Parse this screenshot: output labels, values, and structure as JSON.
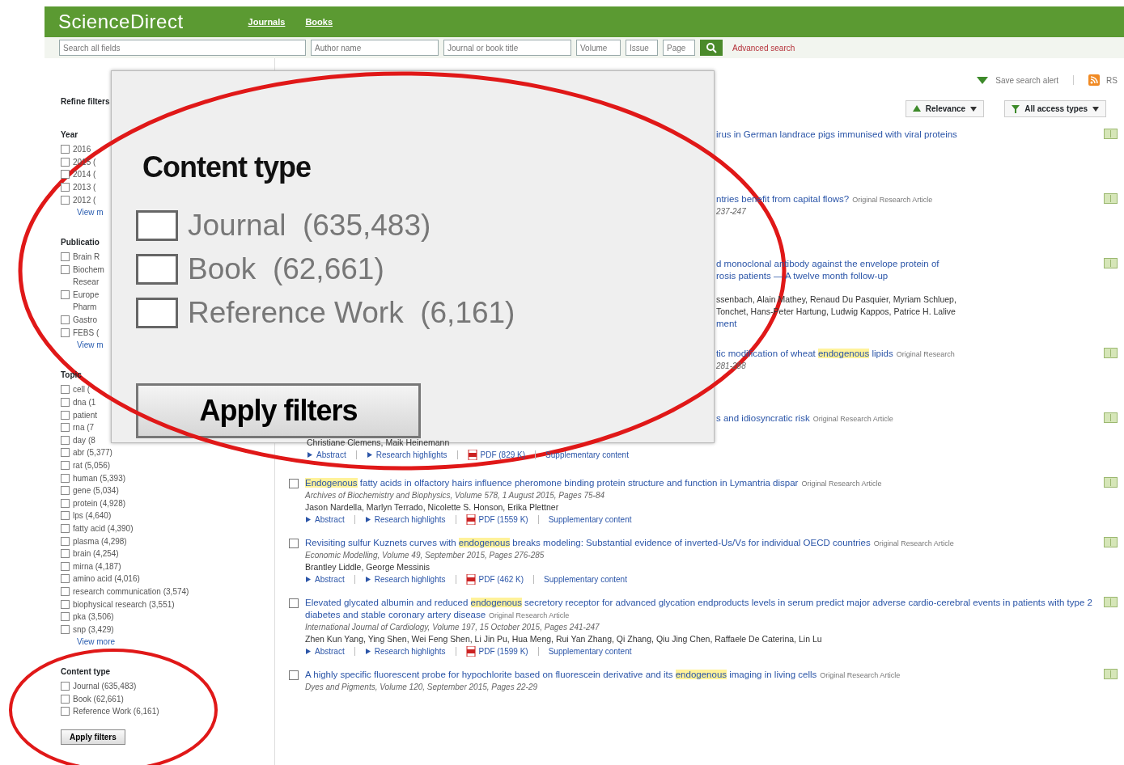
{
  "header": {
    "logo": "ScienceDirect",
    "nav": [
      "Journals",
      "Books"
    ]
  },
  "search": {
    "fields": [
      {
        "placeholder": "Search all fields"
      },
      {
        "placeholder": "Author name"
      },
      {
        "placeholder": "Journal or book title"
      },
      {
        "placeholder": "Volume"
      },
      {
        "placeholder": "Issue"
      },
      {
        "placeholder": "Page"
      }
    ],
    "advanced_link": "Advanced search"
  },
  "sidebar": {
    "title": "Refine filters",
    "groups": [
      {
        "heading": "Year",
        "items": [
          {
            "label": "2016",
            "checked": false
          },
          {
            "label": "2015 (",
            "checked": false
          },
          {
            "label": "2014 (",
            "checked": false
          },
          {
            "label": "2013 (",
            "checked": false
          },
          {
            "label": "2012 (",
            "checked": false
          }
        ],
        "more": "View m"
      },
      {
        "heading": "Publicatio",
        "items": [
          {
            "label": "Brain R",
            "checked": false
          },
          {
            "label": "Biochem",
            "label_cont": "Resear",
            "checked": false
          },
          {
            "label": "Europe",
            "label_cont": "Pharm",
            "checked": false
          },
          {
            "label": "Gastro",
            "checked": false
          },
          {
            "label": "FEBS (",
            "checked": false
          }
        ],
        "more": "View m"
      },
      {
        "heading": "Topic",
        "items": [
          {
            "label": "cell (",
            "checked": false
          },
          {
            "label": "dna (1",
            "checked": false
          },
          {
            "label": "patient",
            "checked": false
          },
          {
            "label": "rna (7",
            "checked": false
          },
          {
            "label": "day (8",
            "checked": false
          },
          {
            "label": "abr (5,377)",
            "checked": false
          },
          {
            "label": "rat (5,056)",
            "checked": false
          },
          {
            "label": "human (5,393)",
            "checked": false
          },
          {
            "label": "gene (5,034)",
            "checked": false
          },
          {
            "label": "protein (4,928)",
            "checked": false
          },
          {
            "label": "lps (4,640)",
            "checked": false
          },
          {
            "label": "fatty acid (4,390)",
            "checked": false
          },
          {
            "label": "plasma (4,298)",
            "checked": false
          },
          {
            "label": "brain (4,254)",
            "checked": false
          },
          {
            "label": "mirna (4,187)",
            "checked": false
          },
          {
            "label": "amino acid (4,016)",
            "checked": false
          },
          {
            "label": "research communication (3,574)",
            "checked": false
          },
          {
            "label": "biophysical research (3,551)",
            "checked": false
          },
          {
            "label": "pka (3,506)",
            "checked": false
          },
          {
            "label": "snp (3,429)",
            "checked": false
          }
        ],
        "more": "View more"
      },
      {
        "heading": "Content type",
        "items": [
          {
            "label": "Journal (635,483)",
            "checked": false
          },
          {
            "label": "Book (62,661)",
            "checked": false
          },
          {
            "label": "Reference Work (6,161)",
            "checked": false
          }
        ]
      }
    ],
    "apply_button": "Apply filters"
  },
  "toolbar": {
    "save_alert": "Save search alert",
    "rss": "RS",
    "sort": "Relevance",
    "access": "All access types"
  },
  "results": [
    {
      "lines": [
        {
          "kind": "title",
          "clipped": true,
          "parts": [
            {
              "text": "irus in German landrace pigs immunised with viral proteins",
              "highlighted": false
            }
          ]
        }
      ]
    },
    {
      "lines": [
        {
          "kind": "title",
          "clipped": true,
          "parts": [
            {
              "text": "ntries benefit from capital flows?",
              "highlighted": false
            }
          ],
          "article_type": "Original Research Article"
        },
        {
          "kind": "source",
          "clipped": true,
          "text": "237-247"
        }
      ]
    },
    {
      "lines": [
        {
          "kind": "title",
          "clipped": true,
          "parts": [
            {
              "text": "d monoclonal antibody against the envelope protein of",
              "highlighted": false
            }
          ]
        },
        {
          "kind": "title",
          "clipped": true,
          "parts": [
            {
              "text": "rosis patients — A twelve month follow-up",
              "highlighted": false
            }
          ]
        },
        {
          "kind": "authors",
          "clipped": true,
          "text": "ssenbach, Alain Mathey, Renaud Du Pasquier, Myriam Schluep,"
        },
        {
          "kind": "authors",
          "clipped": true,
          "text": "Tonchet, Hans-Peter Hartung, Ludwig Kappos, Patrice H. Lalive"
        },
        {
          "kind": "link",
          "clipped": true,
          "text": "ment"
        }
      ]
    },
    {
      "lines": [
        {
          "kind": "title",
          "clipped": true,
          "parts": [
            {
              "text": "tic modification of wheat ",
              "highlighted": false
            },
            {
              "text": "endogenous",
              "highlighted": true
            },
            {
              "text": " lipids",
              "highlighted": false
            }
          ],
          "article_type": "Original Research"
        },
        {
          "kind": "source",
          "clipped": true,
          "text": "281-288"
        }
      ]
    },
    {
      "lines": [
        {
          "kind": "title",
          "clipped": true,
          "parts": [
            {
              "text": "s and idiosyncratic risk",
              "highlighted": false
            }
          ],
          "article_type": "Original Research Article"
        },
        {
          "kind": "authors",
          "text": "Christiane Clemens, Maik Heinemann"
        },
        {
          "kind": "links",
          "items": [
            {
              "kind": "toggle",
              "label": "Abstract"
            },
            {
              "kind": "toggle",
              "label": "Research highlights"
            },
            {
              "kind": "pdf",
              "label": "PDF (829 K)"
            },
            {
              "kind": "plain",
              "label": "Supplementary content"
            }
          ]
        }
      ]
    },
    {
      "checked": false,
      "lines": [
        {
          "kind": "title",
          "parts": [
            {
              "text": "Endogenous",
              "highlighted": true
            },
            {
              "text": " fatty acids in olfactory hairs influence pheromone binding protein structure and function in Lymantria dispar",
              "highlighted": false
            }
          ],
          "article_type": "Original Research Article"
        },
        {
          "kind": "source",
          "text": "Archives of Biochemistry and Biophysics, Volume 578, 1 August 2015, Pages 75-84"
        },
        {
          "kind": "authors",
          "text": "Jason Nardella, Marlyn Terrado, Nicolette S. Honson, Erika Plettner"
        },
        {
          "kind": "links",
          "items": [
            {
              "kind": "toggle",
              "label": "Abstract"
            },
            {
              "kind": "toggle",
              "label": "Research highlights"
            },
            {
              "kind": "pdf",
              "label": "PDF (1559 K)"
            },
            {
              "kind": "plain",
              "label": "Supplementary content"
            }
          ]
        }
      ]
    },
    {
      "checked": false,
      "lines": [
        {
          "kind": "title",
          "parts": [
            {
              "text": "Revisiting sulfur Kuznets curves with ",
              "highlighted": false
            },
            {
              "text": "endogenous",
              "highlighted": true
            },
            {
              "text": " breaks modeling: Substantial evidence of inverted-Us/Vs for individual OECD countries",
              "highlighted": false
            }
          ],
          "article_type": "Original Research Article"
        },
        {
          "kind": "source",
          "text": "Economic Modelling, Volume 49, September 2015, Pages 276-285"
        },
        {
          "kind": "authors",
          "text": "Brantley Liddle, George Messinis"
        },
        {
          "kind": "links",
          "items": [
            {
              "kind": "toggle",
              "label": "Abstract"
            },
            {
              "kind": "toggle",
              "label": "Research highlights"
            },
            {
              "kind": "pdf",
              "label": "PDF (462 K)"
            },
            {
              "kind": "plain",
              "label": "Supplementary content"
            }
          ]
        }
      ]
    },
    {
      "checked": false,
      "lines": [
        {
          "kind": "title",
          "parts": [
            {
              "text": "Elevated glycated albumin and reduced ",
              "highlighted": false
            },
            {
              "text": "endogenous",
              "highlighted": true
            },
            {
              "text": " secretory receptor for advanced glycation endproducts levels in serum predict major adverse cardio-cerebral events in patients with type 2 diabetes and stable coronary artery disease",
              "highlighted": false
            }
          ],
          "article_type": "Original Research Article"
        },
        {
          "kind": "source",
          "text": "International Journal of Cardiology, Volume 197, 15 October 2015, Pages 241-247"
        },
        {
          "kind": "authors",
          "text": "Zhen Kun Yang, Ying Shen, Wei Feng Shen, Li Jin Pu, Hua Meng, Rui Yan Zhang, Qi Zhang, Qiu Jing Chen, Raffaele De Caterina, Lin Lu"
        },
        {
          "kind": "links",
          "items": [
            {
              "kind": "toggle",
              "label": "Abstract"
            },
            {
              "kind": "toggle",
              "label": "Research highlights"
            },
            {
              "kind": "pdf",
              "label": "PDF (1599 K)"
            },
            {
              "kind": "plain",
              "label": "Supplementary content"
            }
          ]
        }
      ]
    },
    {
      "checked": false,
      "lines": [
        {
          "kind": "title",
          "parts": [
            {
              "text": "A highly specific fluorescent probe for hypochlorite based on fluorescein derivative and its ",
              "highlighted": false
            },
            {
              "text": "endogenous",
              "highlighted": true
            },
            {
              "text": " imaging in living cells",
              "highlighted": false
            }
          ],
          "article_type": "Original Research Article"
        },
        {
          "kind": "source",
          "text": "Dyes and Pigments, Volume 120, September 2015, Pages 22-29"
        }
      ]
    }
  ],
  "magnifier": {
    "heading": "Content type",
    "items": [
      {
        "label": "Journal  (635,483)",
        "checked": false
      },
      {
        "label": "Book  (62,661)",
        "checked": false
      },
      {
        "label": "Reference Work  (6,161)",
        "checked": false
      }
    ],
    "button": "Apply filters"
  }
}
